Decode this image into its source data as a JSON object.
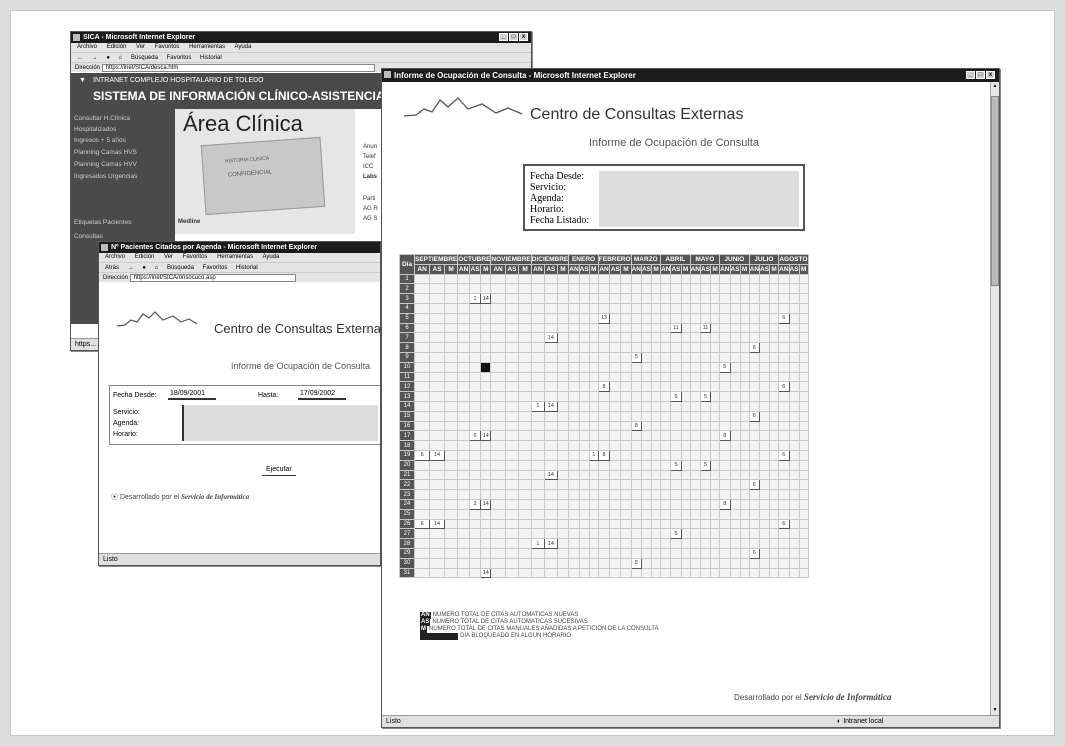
{
  "win1": {
    "title": "SICA - Microsoft Internet Explorer",
    "menu": [
      "Archivo",
      "Edición",
      "Ver",
      "Favoritos",
      "Herramientas",
      "Ayuda"
    ],
    "toolbar": [
      "←",
      "→",
      "●",
      "⌂",
      "Búsqueda",
      "Favoritos",
      "Historial"
    ],
    "address_label": "Dirección",
    "address": "https://inet/SICA/desca.htm",
    "header_line1": "INTRANET COMPLEJO HOSPITALARIO DE TOLEDO",
    "header_line2": "SISTEMA DE INFORMACIÓN CLÍNICO-ASISTENCIAL",
    "area_title": "Área Clínica",
    "nav": [
      "Consultar H.Clínica",
      "Hospitalizados",
      "Ingresos + 5 años",
      "Planning Camas HVS",
      "Planning Camas HVV",
      "Ingresados Urgencias",
      "Etiquetas Pacientes",
      "Consultas"
    ],
    "folder_text1": "HISTORIA CLINICA",
    "folder_text2": "CONFIDENCIAL",
    "right_links": [
      "Anun",
      "Telef",
      "ICC",
      "Labs",
      "Parti",
      "AG R",
      "AG S"
    ],
    "medline": "Medline",
    "status": "https..."
  },
  "win2": {
    "title": "Nº Pacientes Citados por Agenda - Microsoft Internet Explorer",
    "menu": [
      "Archivo",
      "Edición",
      "Ver",
      "Favoritos",
      "Herramientas",
      "Ayuda"
    ],
    "toolbar": [
      "Atrás",
      "→",
      "●",
      "⌂",
      "Búsqueda",
      "Favoritos",
      "Historial"
    ],
    "address_label": "Dirección",
    "address": "https://inet/SICA/onsocuco.asp",
    "site_title": "Centro de Consultas Externas",
    "report_title": "Informe de Ocupación de Consulta",
    "fecha_desde_label": "Fecha Desde:",
    "fecha_desde": "18/09/2001",
    "hasta_label": "Hasta:",
    "hasta": "17/09/2002",
    "servicio_label": "Servicio:",
    "agenda_label": "Agenda:",
    "horario_label": "Horario:",
    "execute_button": "Ejecutar",
    "developed_prefix": "Desarrollado por el",
    "developed_by": "Servicio de Informática",
    "status": "Listo"
  },
  "win3": {
    "title": "Informe de Ocupación de Consulta - Microsoft Internet Explorer",
    "site_title": "Centro de Consultas Externas",
    "report_title": "Informe de Ocupación de Consulta",
    "labels": [
      "Fecha Desde:",
      "Servicio:",
      "Agenda:",
      "Horario:",
      "Fecha Listado:"
    ],
    "day_header": "Día",
    "months": [
      "SEPTIEMBRE",
      "OCTUBRE",
      "NOVIEMBRE",
      "DICIEMBRE",
      "ENERO",
      "FEBRERO",
      "MARZO",
      "ABRIL",
      "MAYO",
      "JUNIO",
      "JULIO",
      "AGOSTO"
    ],
    "subcols": [
      "AN",
      "AS",
      "M"
    ],
    "days": [
      "1",
      "2",
      "3",
      "4",
      "5",
      "6",
      "7",
      "8",
      "9",
      "10",
      "11",
      "12",
      "13",
      "14",
      "15",
      "16",
      "17",
      "18",
      "19",
      "20",
      "21",
      "22",
      "23",
      "24",
      "25",
      "26",
      "27",
      "28",
      "29",
      "30",
      "31"
    ],
    "cells": [
      {
        "day": 3,
        "col": 4,
        "v": "1"
      },
      {
        "day": 3,
        "col": 5,
        "v": "14"
      },
      {
        "day": 5,
        "col": 15,
        "v": "13"
      },
      {
        "day": 5,
        "col": 33,
        "v": "6"
      },
      {
        "day": 6,
        "col": 22,
        "v": "11"
      },
      {
        "day": 6,
        "col": 25,
        "v": "11"
      },
      {
        "day": 7,
        "col": 10,
        "v": "14"
      },
      {
        "day": 8,
        "col": 30,
        "v": "6"
      },
      {
        "day": 9,
        "col": 18,
        "v": "5"
      },
      {
        "day": 10,
        "col": 5,
        "v": "",
        "black": true
      },
      {
        "day": 10,
        "col": 27,
        "v": "5"
      },
      {
        "day": 12,
        "col": 15,
        "v": "8"
      },
      {
        "day": 12,
        "col": 33,
        "v": "6"
      },
      {
        "day": 13,
        "col": 22,
        "v": "5"
      },
      {
        "day": 13,
        "col": 25,
        "v": "5"
      },
      {
        "day": 14,
        "col": 9,
        "v": "1"
      },
      {
        "day": 14,
        "col": 10,
        "v": "14"
      },
      {
        "day": 15,
        "col": 30,
        "v": "6"
      },
      {
        "day": 16,
        "col": 18,
        "v": "8"
      },
      {
        "day": 17,
        "col": 4,
        "v": "6"
      },
      {
        "day": 17,
        "col": 5,
        "v": "14"
      },
      {
        "day": 17,
        "col": 27,
        "v": "8"
      },
      {
        "day": 19,
        "col": 0,
        "v": "6"
      },
      {
        "day": 19,
        "col": 1,
        "v": "14"
      },
      {
        "day": 19,
        "col": 14,
        "v": "1"
      },
      {
        "day": 19,
        "col": 15,
        "v": "8"
      },
      {
        "day": 19,
        "col": 33,
        "v": "6"
      },
      {
        "day": 20,
        "col": 22,
        "v": "5"
      },
      {
        "day": 20,
        "col": 25,
        "v": "5"
      },
      {
        "day": 21,
        "col": 10,
        "v": "14"
      },
      {
        "day": 22,
        "col": 30,
        "v": "6"
      },
      {
        "day": 24,
        "col": 4,
        "v": "2"
      },
      {
        "day": 24,
        "col": 5,
        "v": "14"
      },
      {
        "day": 24,
        "col": 27,
        "v": "8"
      },
      {
        "day": 26,
        "col": 0,
        "v": "6"
      },
      {
        "day": 26,
        "col": 1,
        "v": "14"
      },
      {
        "day": 26,
        "col": 33,
        "v": "6"
      },
      {
        "day": 27,
        "col": 22,
        "v": "5"
      },
      {
        "day": 28,
        "col": 9,
        "v": "1"
      },
      {
        "day": 28,
        "col": 10,
        "v": "14"
      },
      {
        "day": 29,
        "col": 30,
        "v": "6"
      },
      {
        "day": 30,
        "col": 18,
        "v": "5"
      },
      {
        "day": 31,
        "col": 5,
        "v": "14"
      }
    ],
    "legend": [
      {
        "code": "AN",
        "text": "NUMERO TOTAL DE CITAS AUTOMATICAS NUEVAS"
      },
      {
        "code": "AS",
        "text": "NUMERO TOTAL DE CITAS AUTOMATICAS SUCESIVAS"
      },
      {
        "code": "M",
        "text": "NUMERO TOTAL DE CITAS MANUALES AÑADIDAS A PETICION DE LA CONSULTA"
      },
      {
        "code": "",
        "text": "DIA BLOQUEADO EN ALGUN HORARIO"
      }
    ],
    "developed_prefix": "Desarrollado por el",
    "developed_by": "Servicio de Informática",
    "status": "Listo",
    "zone": "Intranet local"
  },
  "colors": {
    "dark": "#1b1b1b",
    "header_bg": "#4a4a4a",
    "grid_head": "#555555"
  }
}
